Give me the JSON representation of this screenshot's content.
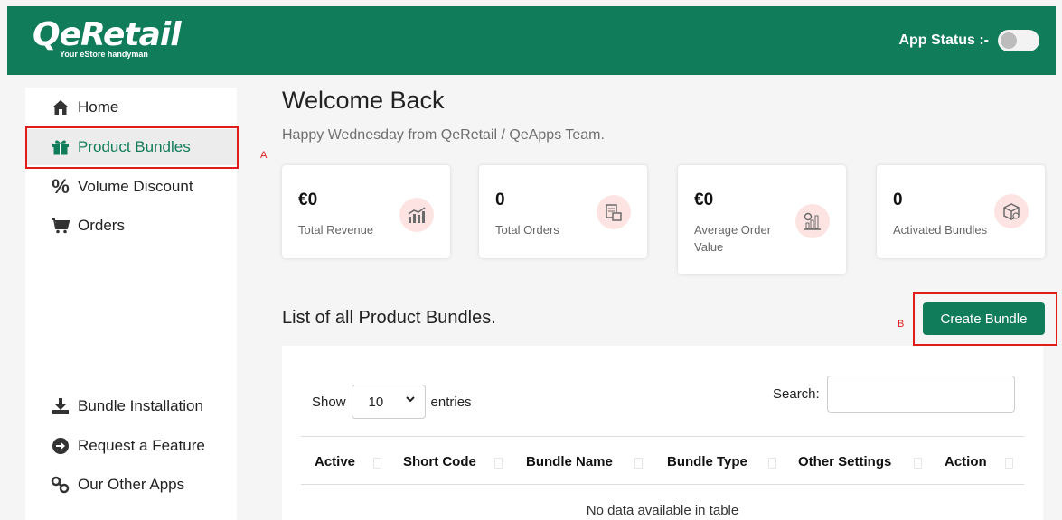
{
  "header": {
    "logo_text": "QeRetail",
    "tagline": "Your eStore handyman",
    "app_status_label": "App Status :-"
  },
  "sidebar": {
    "items": [
      {
        "label": "Home",
        "icon": "home-icon"
      },
      {
        "label": "Product Bundles",
        "icon": "gift-icon"
      },
      {
        "label": "Volume Discount",
        "icon": "percent-icon"
      },
      {
        "label": "Orders",
        "icon": "cart-icon"
      }
    ],
    "bottom_items": [
      {
        "label": "Bundle Installation",
        "icon": "download-icon"
      },
      {
        "label": "Request a Feature",
        "icon": "arrow-circle-icon"
      },
      {
        "label": "Our Other Apps",
        "icon": "link-icon"
      }
    ]
  },
  "annotations": {
    "a": "A",
    "b": "B"
  },
  "main": {
    "title": "Welcome Back",
    "greeting": "Happy Wednesday from QeRetail / QeApps Team.",
    "stats": [
      {
        "value": "€0",
        "label": "Total Revenue",
        "icon": "revenue-chart-icon"
      },
      {
        "value": "0",
        "label": "Total Orders",
        "icon": "orders-box-icon"
      },
      {
        "value": "€0",
        "label": "Average Order Value",
        "icon": "bar-chart-icon"
      },
      {
        "value": "0",
        "label": "Activated Bundles",
        "icon": "bundle-box-icon"
      }
    ],
    "list_title": "List of all Product Bundles.",
    "create_button": "Create Bundle"
  },
  "table": {
    "show_label": "Show",
    "entries_value": "10",
    "entries_label": "entries",
    "search_label": "Search:",
    "search_value": "",
    "columns": [
      "Active",
      "Short Code",
      "Bundle Name",
      "Bundle Type",
      "Other Settings",
      "Action"
    ],
    "empty_message": "No data available in table"
  },
  "colors": {
    "brand": "#117c5a",
    "highlight": "#e21b1b"
  }
}
